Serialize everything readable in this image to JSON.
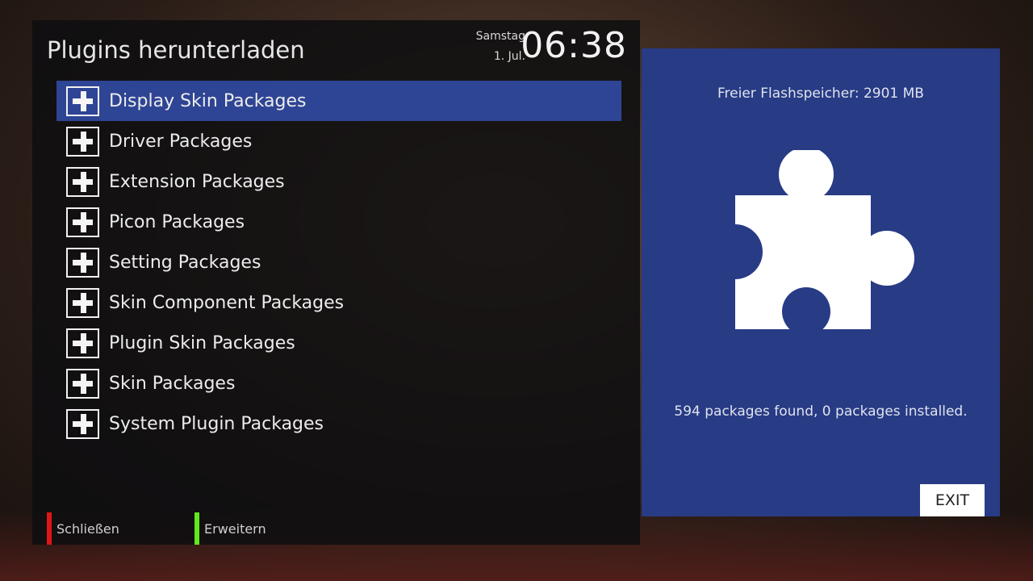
{
  "header": {
    "title": "Plugins herunterladen",
    "weekday": "Samstag",
    "date": "1. Jul.",
    "time": "06:38"
  },
  "packages": [
    {
      "label": "Display Skin Packages",
      "icon": "plus-icon",
      "selected": true
    },
    {
      "label": "Driver Packages",
      "icon": "plus-icon"
    },
    {
      "label": "Extension Packages",
      "icon": "plus-icon"
    },
    {
      "label": "Picon Packages",
      "icon": "plus-icon"
    },
    {
      "label": "Setting Packages",
      "icon": "plus-icon"
    },
    {
      "label": "Skin Component Packages",
      "icon": "plus-icon"
    },
    {
      "label": "Plugin Skin Packages",
      "icon": "plus-icon"
    },
    {
      "label": "Skin Packages",
      "icon": "plus-icon"
    },
    {
      "label": "System Plugin Packages",
      "icon": "plus-icon"
    }
  ],
  "footer": {
    "red_label": "Schließen",
    "green_label": "Erweitern",
    "red_color": "#e01515",
    "green_color": "#5fe81e"
  },
  "info": {
    "flash": "Freier Flashspeicher: 2901 MB",
    "icon": "puzzle-icon",
    "found": "594 packages found, 0 packages installed.",
    "exit_label": "EXIT"
  },
  "colors": {
    "selection": "#2e4494",
    "info_panel": "#283b85"
  }
}
